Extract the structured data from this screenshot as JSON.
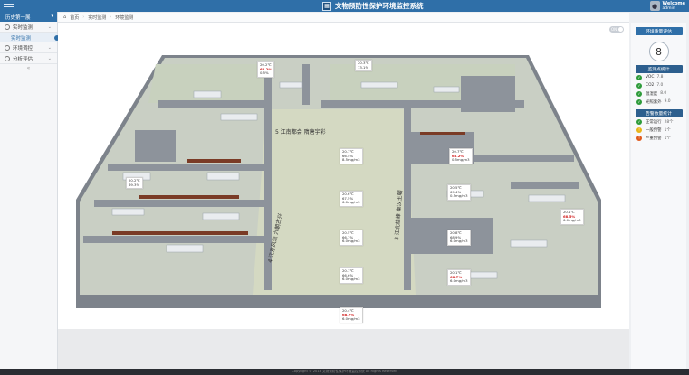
{
  "app": {
    "title": "文物预防性保护环境监控系统",
    "logo_icon": "museum-logo"
  },
  "user": {
    "name": "Welcome",
    "role": "admin"
  },
  "sidebar": {
    "header": "历史第一展",
    "items": [
      {
        "label": "实时监测",
        "icon": "clock-icon"
      },
      {
        "label": "环境调控",
        "icon": "sliders-icon"
      },
      {
        "label": "分析评估",
        "icon": "chart-icon"
      }
    ],
    "sub_item": "实时监测"
  },
  "breadcrumb": {
    "home": "首页",
    "level1": "实时监测",
    "level2": "环境监测"
  },
  "main": {
    "toggle_label": "ON",
    "floor_labels": [
      "5 江南都会  隋唐宇彩",
      "4 江东风流  六朝古兴",
      "3 江北雄峰  秦汉王朝"
    ]
  },
  "sensors": [
    {
      "temp": "20.2℃",
      "rh": "68.2%",
      "extra": "0.5%"
    },
    {
      "temp": "20.3℃",
      "rh": "73.1%",
      "extra": ""
    },
    {
      "temp": "20.7℃",
      "rh": "68.2%",
      "extra": "0.5mg/m3"
    },
    {
      "temp": "20.2℃",
      "rh": "69.3%",
      "extra": ""
    },
    {
      "temp": "20.7℃",
      "rh": "66.4%",
      "extra": "8.5mg/m3"
    },
    {
      "temp": "20.5℃",
      "rh": "69.4%",
      "extra": "0.5mg/m3"
    },
    {
      "temp": "20.6℃",
      "rh": "67.5%",
      "extra": "6.0mg/m3"
    },
    {
      "temp": "20.1℃",
      "rh": "68.5%",
      "extra": "6.0mg/m3"
    },
    {
      "temp": "20.5℃",
      "rh": "66.7%",
      "extra": "6.0mg/m3"
    },
    {
      "temp": "20.8℃",
      "rh": "68.9%",
      "extra": "6.0mg/m3"
    },
    {
      "temp": "20.1℃",
      "rh": "66.6%",
      "extra": "6.0mg/m3"
    },
    {
      "temp": "20.1℃",
      "rh": "68.7%",
      "extra": "6.0mg/m3"
    },
    {
      "temp": "20.4℃",
      "rh": "68.7%",
      "extra": "6.0mg/m3"
    }
  ],
  "right_panel": {
    "title1": "环境质量评估",
    "score": "8",
    "title2": "监测点统计",
    "stats": [
      {
        "label": "VOC",
        "value": "7.8",
        "color": "#2e9b3a"
      },
      {
        "label": "CO2",
        "value": "7.0",
        "color": "#2e9b3a"
      },
      {
        "label": "温湿度",
        "value": "8.0",
        "color": "#2e9b3a"
      },
      {
        "label": "光照紫外",
        "value": "9.0",
        "color": "#2e9b3a"
      }
    ],
    "title3": "告警数量统计",
    "alerts": [
      {
        "label": "正常运行",
        "value": "28个",
        "color": "#2e9b3a",
        "icon": "check-icon"
      },
      {
        "label": "一般预警",
        "value": "1个",
        "color": "#e8b417",
        "icon": "warning-icon"
      },
      {
        "label": "严重预警",
        "value": "1个",
        "color": "#e05a1c",
        "icon": "alert-icon"
      }
    ]
  },
  "footer": {
    "text": "Copyright © 2018  文物预防性保护环境监控系统  All Rights Reserved"
  }
}
